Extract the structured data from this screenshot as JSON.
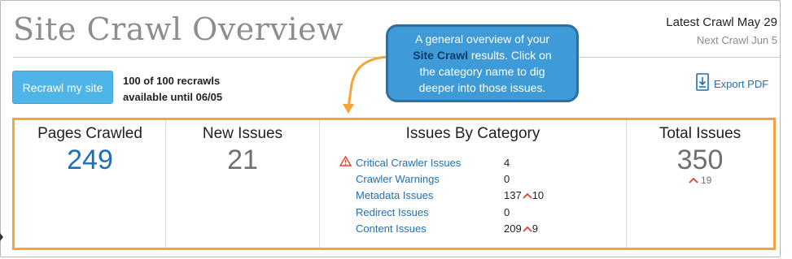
{
  "header": {
    "title": "Site Crawl Overview",
    "latest_crawl": "Latest Crawl May 29",
    "next_crawl": "Next Crawl Jun 5"
  },
  "recrawl": {
    "button_label": "Recrawl my site",
    "info_line1": "100 of 100 recrawls",
    "info_line2": "available until 06/05"
  },
  "export": {
    "label": "Export PDF",
    "icon": "export-pdf-icon"
  },
  "tooltip": {
    "line1": "A general overview of your",
    "bold": "Site Crawl",
    "line2_rest": " results. Click on",
    "line3": "the category name to dig",
    "line4": "deeper into those issues."
  },
  "stats": {
    "pages_crawled": {
      "label": "Pages Crawled",
      "value": "249"
    },
    "new_issues": {
      "label": "New Issues",
      "value": "21"
    },
    "issues_by_category": {
      "label": "Issues By Category",
      "items": [
        {
          "name": "Critical Crawler Issues",
          "count": "4",
          "delta": "",
          "warning": true
        },
        {
          "name": "Crawler Warnings",
          "count": "0",
          "delta": "",
          "warning": false
        },
        {
          "name": "Metadata Issues",
          "count": "137",
          "delta": "10",
          "warning": false
        },
        {
          "name": "Redirect Issues",
          "count": "0",
          "delta": "",
          "warning": false
        },
        {
          "name": "Content Issues",
          "count": "209",
          "delta": "9",
          "warning": false
        }
      ]
    },
    "total_issues": {
      "label": "Total Issues",
      "value": "350",
      "delta": "19"
    }
  },
  "colors": {
    "accent_blue": "#1f6fb6",
    "button_blue": "#4fb4e8",
    "highlight_orange": "#f5a33a",
    "delta_red": "#e0412d",
    "tooltip_blue": "#3e9bd8"
  }
}
